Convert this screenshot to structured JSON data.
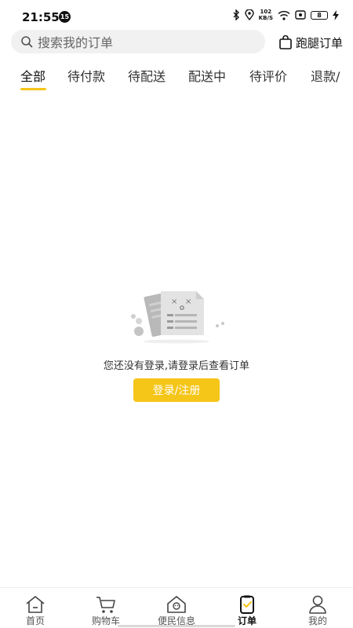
{
  "status_bar": {
    "time": "21:55",
    "notification_count": "15",
    "net_speed_value": "102",
    "net_speed_unit": "KB/S",
    "battery_level": "8"
  },
  "search": {
    "placeholder": "搜索我的订单"
  },
  "header": {
    "errand_label": "跑腿订单"
  },
  "tabs": [
    {
      "label": "全部",
      "active": true
    },
    {
      "label": "待付款"
    },
    {
      "label": "待配送"
    },
    {
      "label": "配送中"
    },
    {
      "label": "待评价"
    },
    {
      "label": "退款/"
    }
  ],
  "empty_state": {
    "message": "您还没有登录,请登录后查看订单",
    "button_label": "登录/注册"
  },
  "bottom_nav": [
    {
      "label": "首页",
      "icon": "home-icon"
    },
    {
      "label": "购物车",
      "icon": "cart-icon"
    },
    {
      "label": "便民信息",
      "icon": "community-icon"
    },
    {
      "label": "订单",
      "icon": "order-icon",
      "active": true
    },
    {
      "label": "我的",
      "icon": "profile-icon"
    }
  ],
  "colors": {
    "accent": "#f5c518",
    "text": "#222222",
    "muted": "#666666"
  }
}
